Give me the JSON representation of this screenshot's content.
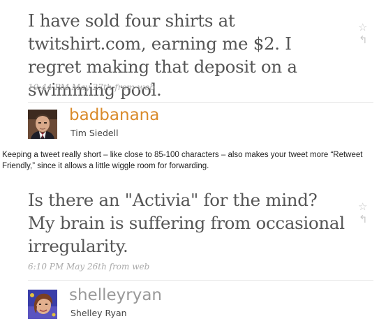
{
  "tweets": [
    {
      "text": "I have sold four shirts at twitshirt.com, earning me $2. I regret making that deposit on a swimming pool.",
      "time": "10:44 PM May 27th",
      "source_prefix": "from",
      "source": "web",
      "screen_name": "badbanana",
      "full_name": "Tim Siedell",
      "screen_name_color": "#d98a2a"
    },
    {
      "text": "Is there an \"Activia\" for the mind? My brain is suffering from occasional irregularity.",
      "time": "6:10 PM May 26th",
      "source_prefix": "from",
      "source": "web",
      "screen_name": "shelleyryan",
      "full_name": "Shelley Ryan",
      "screen_name_color": "#999999"
    }
  ],
  "caption": "Keeping a tweet really short – like close to 85-100 characters – also makes your tweet more “Retweet Friendly,” since it allows a little wiggle room for forwarding.",
  "icons": {
    "favorite": "star-outline-icon",
    "reply": "reply-arrow-icon"
  },
  "colors": {
    "tweet_text": "#555555",
    "meta_text": "#aaaaaa",
    "icon": "#c8c8c8",
    "divider": "#e6e6e6"
  }
}
